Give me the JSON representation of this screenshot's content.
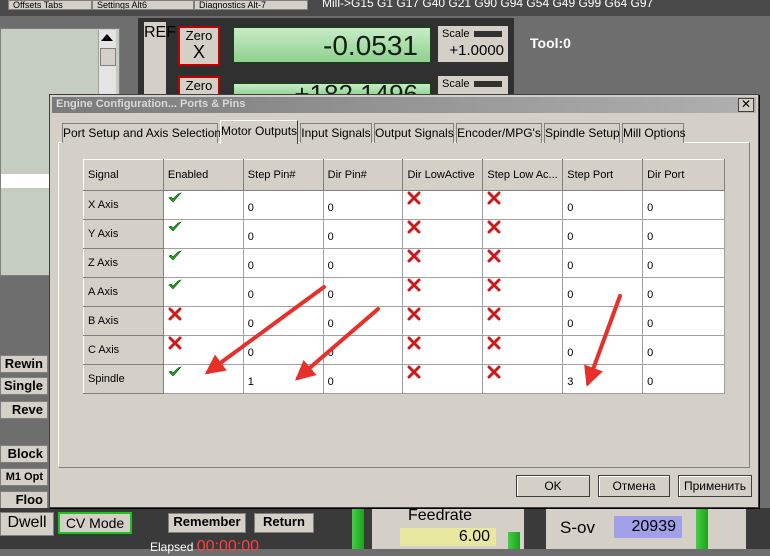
{
  "background": {
    "top_buttons": [
      "Offsets Tabs",
      "Settings Alt6",
      "Diagnostics Alt-7"
    ],
    "ticker": "Mill->G15  G1 G17 G40 G21 G90 G94 G54 G49 G99 G64 G97",
    "ref_label": "REF",
    "zero_label": "Zero",
    "axis_x": "X",
    "dro_x": "-0.0531",
    "dro_y": "+182.1496",
    "scale_label": "Scale",
    "scale_value": "+1.0000",
    "tool": "Tool:0",
    "side_buttons": [
      "Rewin",
      "Single",
      "Reve",
      "Block",
      "M1 Opt",
      "Floo"
    ],
    "dwell": "Dwell",
    "cv_mode": "CV Mode",
    "remember": "Remember",
    "return": "Return",
    "elapsed_label": "Elapsed",
    "elapsed_value": "00:00:00",
    "feedrate_label": "Feedrate",
    "feedrate_value": "6.00",
    "sov_label": "S-ov",
    "sov_value": "20939"
  },
  "dialog": {
    "title": "Engine Configuration... Ports & Pins",
    "close_label": "✕",
    "tabs": [
      {
        "label": "Port Setup and Axis Selection",
        "active": false
      },
      {
        "label": "Motor Outputs",
        "active": true
      },
      {
        "label": "Input Signals",
        "active": false
      },
      {
        "label": "Output Signals",
        "active": false
      },
      {
        "label": "Encoder/MPG's",
        "active": false
      },
      {
        "label": "Spindle Setup",
        "active": false
      },
      {
        "label": "Mill Options",
        "active": false
      }
    ],
    "table": {
      "columns": [
        "Signal",
        "Enabled",
        "Step Pin#",
        "Dir Pin#",
        "Dir LowActive",
        "Step Low Ac...",
        "Step Port",
        "Dir Port"
      ],
      "rows": [
        {
          "signal": "X Axis",
          "enabled": true,
          "step_pin": "0",
          "dir_pin": "0",
          "dir_low_active": false,
          "step_low_active": false,
          "step_port": "0",
          "dir_port": "0"
        },
        {
          "signal": "Y Axis",
          "enabled": true,
          "step_pin": "0",
          "dir_pin": "0",
          "dir_low_active": false,
          "step_low_active": false,
          "step_port": "0",
          "dir_port": "0"
        },
        {
          "signal": "Z Axis",
          "enabled": true,
          "step_pin": "0",
          "dir_pin": "0",
          "dir_low_active": false,
          "step_low_active": false,
          "step_port": "0",
          "dir_port": "0"
        },
        {
          "signal": "A Axis",
          "enabled": true,
          "step_pin": "0",
          "dir_pin": "0",
          "dir_low_active": false,
          "step_low_active": false,
          "step_port": "0",
          "dir_port": "0"
        },
        {
          "signal": "B Axis",
          "enabled": false,
          "step_pin": "0",
          "dir_pin": "0",
          "dir_low_active": false,
          "step_low_active": false,
          "step_port": "0",
          "dir_port": "0"
        },
        {
          "signal": "C Axis",
          "enabled": false,
          "step_pin": "0",
          "dir_pin": "0",
          "dir_low_active": false,
          "step_low_active": false,
          "step_port": "0",
          "dir_port": "0"
        },
        {
          "signal": "Spindle",
          "enabled": true,
          "step_pin": "1",
          "dir_pin": "0",
          "dir_low_active": false,
          "step_low_active": false,
          "step_port": "3",
          "dir_port": "0"
        }
      ]
    },
    "buttons": {
      "ok": "OK",
      "cancel": "Отмена",
      "apply": "Применить"
    }
  },
  "colors": {
    "annotation_arrow": "#e8302a",
    "check_green": "#1fa01f",
    "cross_red": "#d01818"
  },
  "icons": {
    "enabled": "green-check-icon",
    "disabled": "red-x-icon"
  }
}
